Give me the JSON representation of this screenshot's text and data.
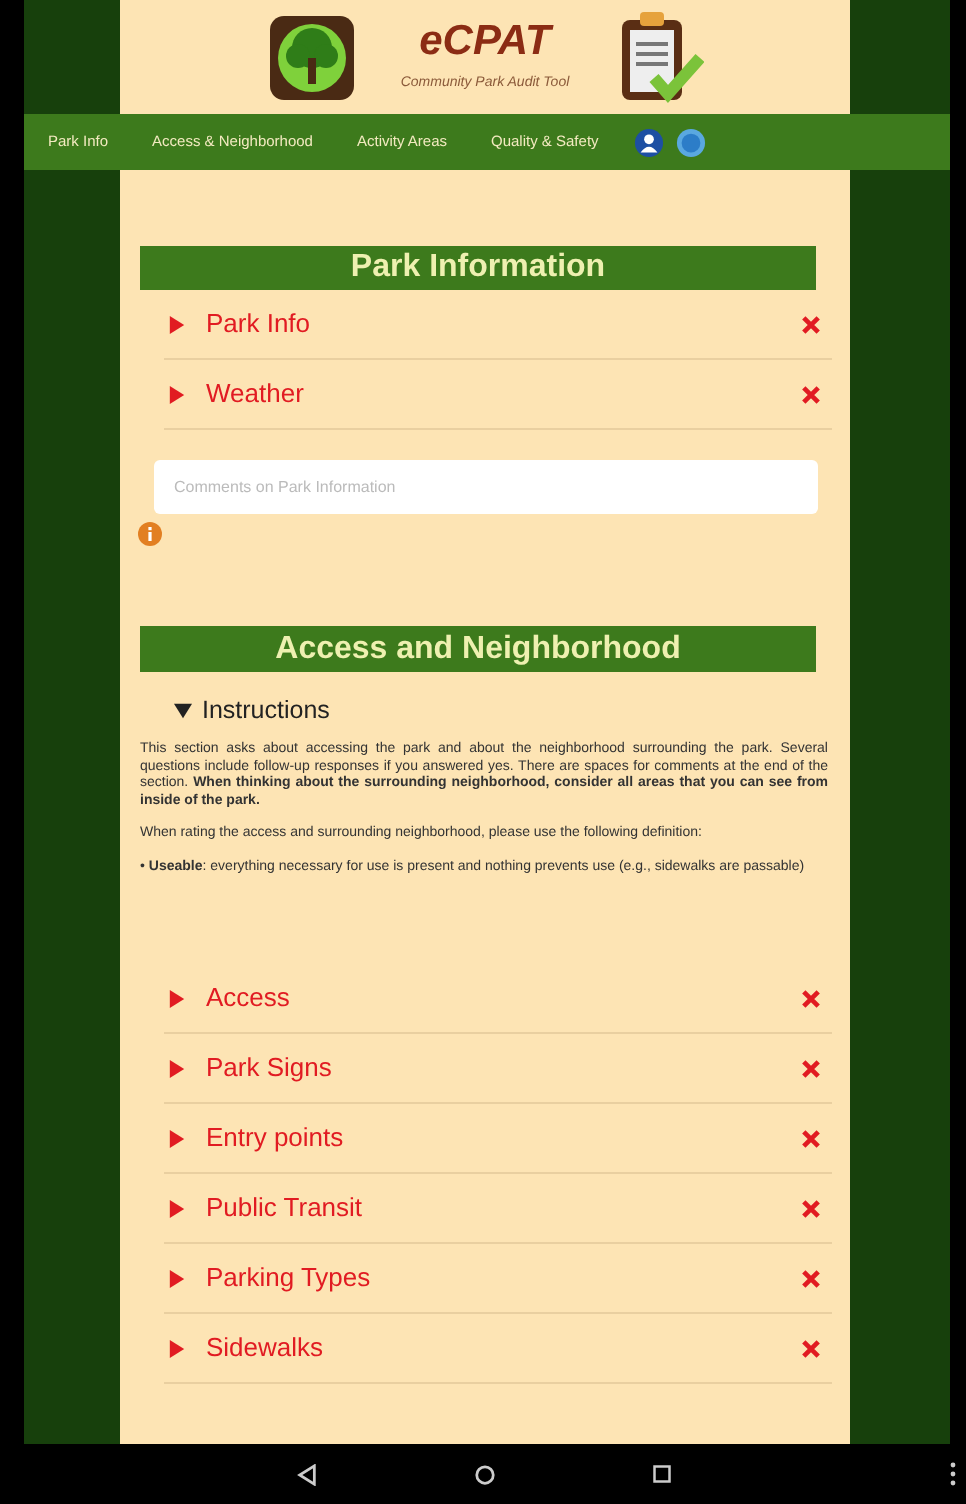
{
  "header": {
    "title": "eCPAT",
    "subtitle": "Community Park Audit Tool"
  },
  "nav": {
    "tabs": [
      {
        "label": "Park Info"
      },
      {
        "label": "Access & Neighborhood"
      },
      {
        "label": "Activity Areas"
      },
      {
        "label": "Quality & Safety"
      }
    ]
  },
  "sections": [
    {
      "title": "Park Information",
      "rows": [
        {
          "label": "Park Info",
          "expanded": false
        },
        {
          "label": "Weather",
          "expanded": false
        }
      ],
      "comment": {
        "placeholder": "Comments on Park Information"
      }
    },
    {
      "title": "Access and Neighborhood",
      "instructions": {
        "label": "Instructions",
        "expanded": true,
        "paragraphs": [
          "This section asks about accessing the park and about the neighborhood surrounding the park. Several questions include follow-up responses if you answered yes. There are spaces for comments at the end of the section. **When thinking about the surrounding neighborhood, consider all areas that you can see from inside of the park.**",
          "When rating the access and surrounding neighborhood, please use the following definition:",
          "• **Useable**: everything necessary for use is present and nothing prevents use (e.g., sidewalks are passable)"
        ]
      },
      "rows": [
        {
          "label": "Access",
          "expanded": false
        },
        {
          "label": "Park Signs",
          "expanded": false
        },
        {
          "label": "Entry points",
          "expanded": false
        },
        {
          "label": "Public Transit",
          "expanded": false
        },
        {
          "label": "Parking Types",
          "expanded": false
        },
        {
          "label": "Sidewalks",
          "expanded": false
        }
      ]
    }
  ]
}
